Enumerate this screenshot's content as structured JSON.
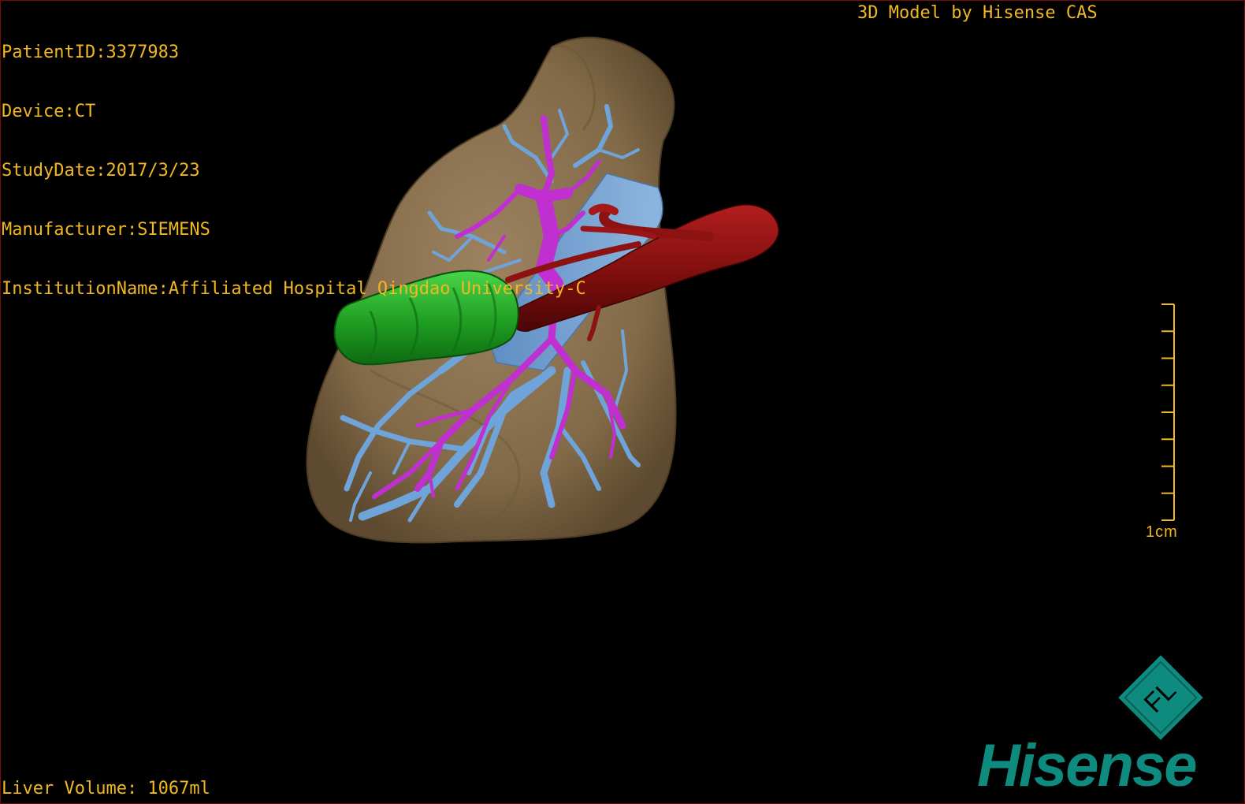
{
  "header": {
    "patient_id": "PatientID:3377983",
    "device": "Device:CT",
    "study_date": "StudyDate:2017/3/23",
    "manufacturer": "Manufacturer:SIEMENS",
    "institution": "InstitutionName:Affiliated Hospital Qingdao University-C"
  },
  "credit": "3D Model by Hisense CAS",
  "footer": {
    "liver_volume": "Liver Volume: 1067ml"
  },
  "scale_bar": {
    "label": "1cm",
    "tick_count": 9
  },
  "logo": {
    "mark_text": "FL",
    "wordmark": "Hisense"
  },
  "colors": {
    "overlay_text": "#f2b820",
    "liver": "#8a7150",
    "portal_vein": "#6fa4db",
    "hepatic_vein": "#c02fd0",
    "artery": "#7a0d0d",
    "tumor": "#1c9d1f",
    "brand": "#0e8a7e"
  },
  "icons": {
    "logo_mark": "hisense-fl-diamond-icon"
  }
}
